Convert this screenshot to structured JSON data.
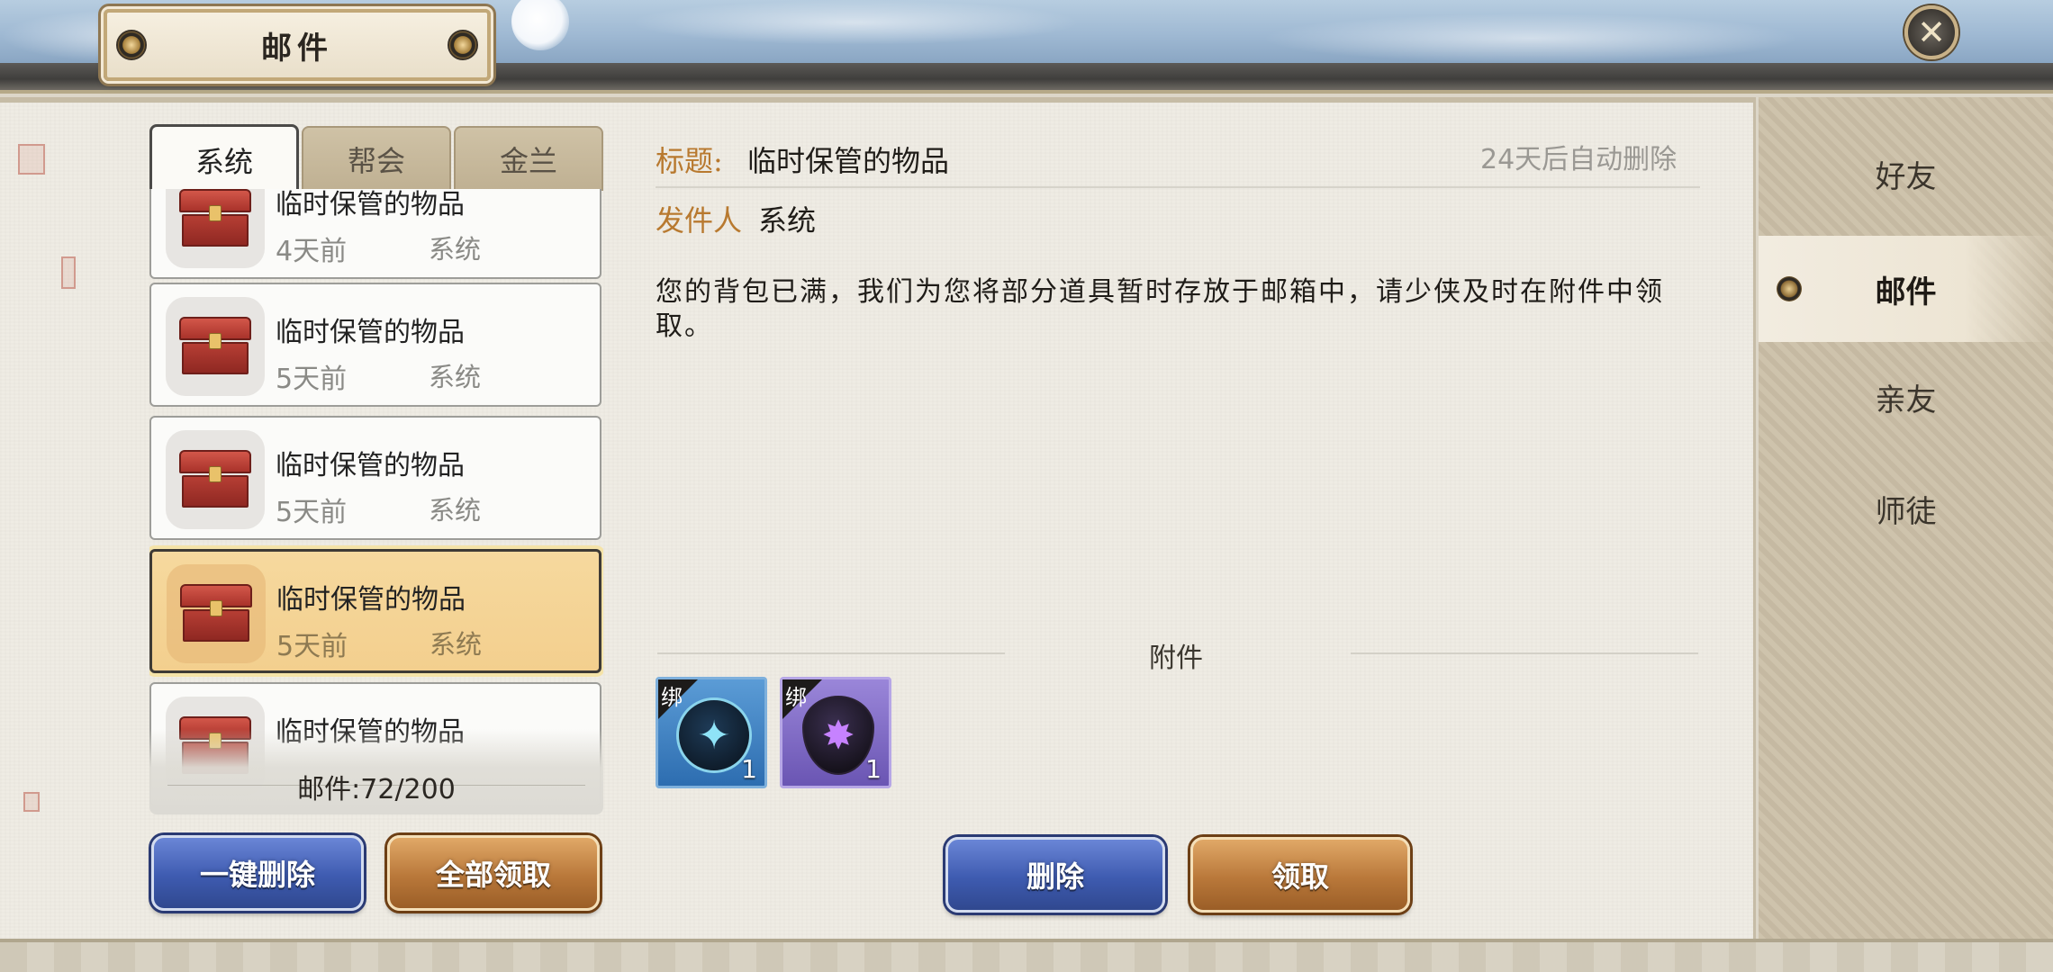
{
  "window": {
    "title": "邮件"
  },
  "tabs": [
    {
      "label": "系统",
      "active": true
    },
    {
      "label": "帮会",
      "active": false
    },
    {
      "label": "金兰",
      "active": false
    }
  ],
  "mails": [
    {
      "title": "临时保管的物品",
      "time": "4天前",
      "sender": "系统",
      "selected": false
    },
    {
      "title": "临时保管的物品",
      "time": "5天前",
      "sender": "系统",
      "selected": false
    },
    {
      "title": "临时保管的物品",
      "time": "5天前",
      "sender": "系统",
      "selected": false
    },
    {
      "title": "临时保管的物品",
      "time": "5天前",
      "sender": "系统",
      "selected": true
    },
    {
      "title": "临时保管的物品",
      "time": "",
      "sender": "",
      "selected": false
    }
  ],
  "list_footer": {
    "count": "邮件:72/200"
  },
  "list_actions": {
    "delete_all": "一键删除",
    "claim_all": "全部领取"
  },
  "detail": {
    "subject_label": "标题:",
    "subject": "临时保管的物品",
    "expire": "24天后自动删除",
    "sender_label": "发件人",
    "sender": "系统",
    "body": "您的背包已满，我们为您将部分道具暂时存放于邮箱中，请少侠及时在附件中领取。",
    "attachments_label": "附件",
    "attachments": [
      {
        "bind_tag": "绑",
        "quantity": "1",
        "icon": "energy-orb-icon",
        "rarity": "blue"
      },
      {
        "bind_tag": "绑",
        "quantity": "1",
        "icon": "shadow-shield-icon",
        "rarity": "purple"
      }
    ],
    "delete_label": "删除",
    "claim_label": "领取"
  },
  "side_nav": [
    {
      "label": "好友",
      "active": false
    },
    {
      "label": "邮件",
      "active": true
    },
    {
      "label": "亲友",
      "active": false
    },
    {
      "label": "师徒",
      "active": false
    }
  ],
  "colors": {
    "accent_gold": "#b8792f",
    "selected_row": "#f3cf8e",
    "blue_button": "#3e5bb0",
    "gold_button": "#b9783a"
  }
}
